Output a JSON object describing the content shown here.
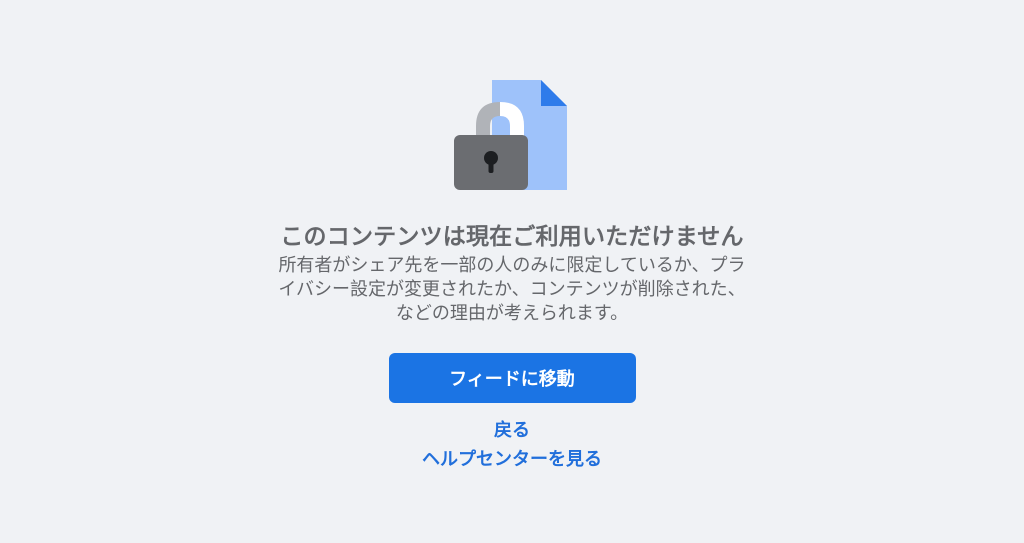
{
  "error": {
    "title": "このコンテンツは現在ご利用いただけません",
    "description_lines": [
      "所有者がシェア先を一部の人のみに限定しているか、プラ",
      "イバシー設定が変更されたか、コンテンツが削除された、",
      "などの理由が考えられます。"
    ]
  },
  "actions": {
    "go_to_feed": "フィードに移動",
    "back": "戻る",
    "help_center": "ヘルプセンターを見る"
  },
  "icons": {
    "illustration": "locked-document-icon"
  },
  "colors": {
    "background": "#f0f2f5",
    "primary": "#1b74e4",
    "link": "#216fdb",
    "text_secondary": "#65676b",
    "doc_light": "#9ec2fa",
    "doc_dark": "#2e7bea",
    "lock_body": "#6b6d71",
    "shackle_grey": "#b0b3b8"
  }
}
